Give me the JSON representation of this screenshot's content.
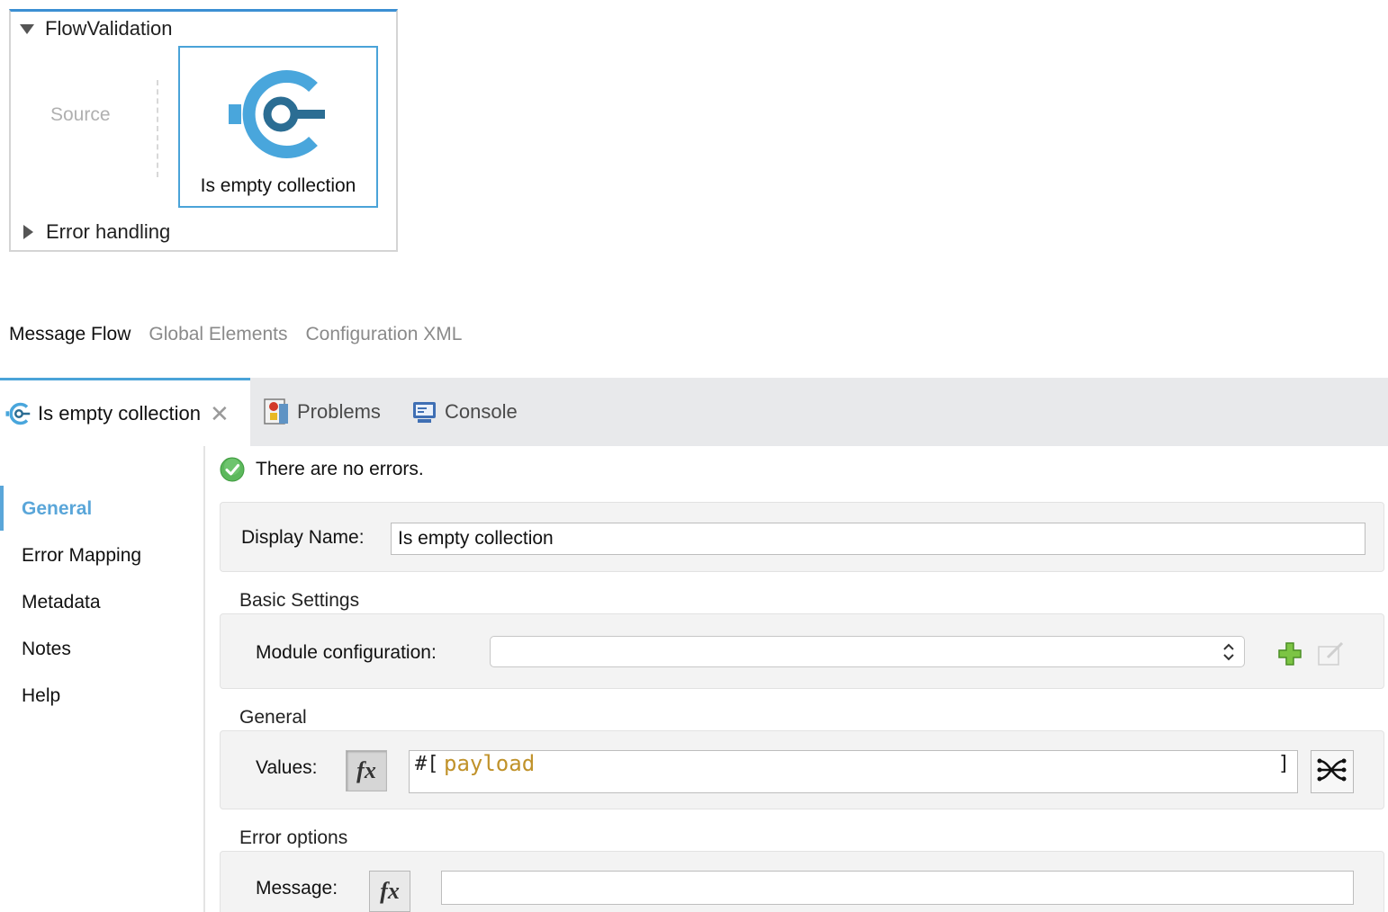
{
  "flow": {
    "name": "FlowValidation",
    "source_label": "Source",
    "component_label": "Is empty collection",
    "error_handling_label": "Error handling"
  },
  "editor_tabs": [
    {
      "label": "Message Flow",
      "active": true
    },
    {
      "label": "Global Elements",
      "active": false
    },
    {
      "label": "Configuration XML",
      "active": false
    }
  ],
  "view_tabs": [
    {
      "label": "Is empty collection",
      "icon": "validation-icon",
      "active": true,
      "close": "✕"
    },
    {
      "label": "Problems",
      "icon": "problems-icon",
      "active": false
    },
    {
      "label": "Console",
      "icon": "console-icon",
      "active": false
    }
  ],
  "side_nav": [
    {
      "label": "General",
      "active": true
    },
    {
      "label": "Error Mapping",
      "active": false
    },
    {
      "label": "Metadata",
      "active": false
    },
    {
      "label": "Notes",
      "active": false
    },
    {
      "label": "Help",
      "active": false
    }
  ],
  "status": {
    "text": "There are no errors.",
    "icon": "check-circle-icon",
    "color": "#4caf50"
  },
  "display_name": {
    "label": "Display Name:",
    "value": "Is empty collection"
  },
  "basic_settings": {
    "title": "Basic Settings",
    "module_config_label": "Module configuration:",
    "module_config_value": ""
  },
  "general": {
    "title": "General",
    "values_label": "Values:",
    "fx_label": "fx",
    "expr_open": "#[",
    "expr_value": "payload",
    "expr_close": "]"
  },
  "error_options": {
    "title": "Error options",
    "message_label": "Message:",
    "fx_label": "fx",
    "message_value": ""
  },
  "colors": {
    "accent": "#4aa3d8",
    "icon_dark": "#2b6d93",
    "icon_light": "#49a6dc",
    "add_green": "#6cbf3c",
    "payload_text": "#c0922a"
  }
}
